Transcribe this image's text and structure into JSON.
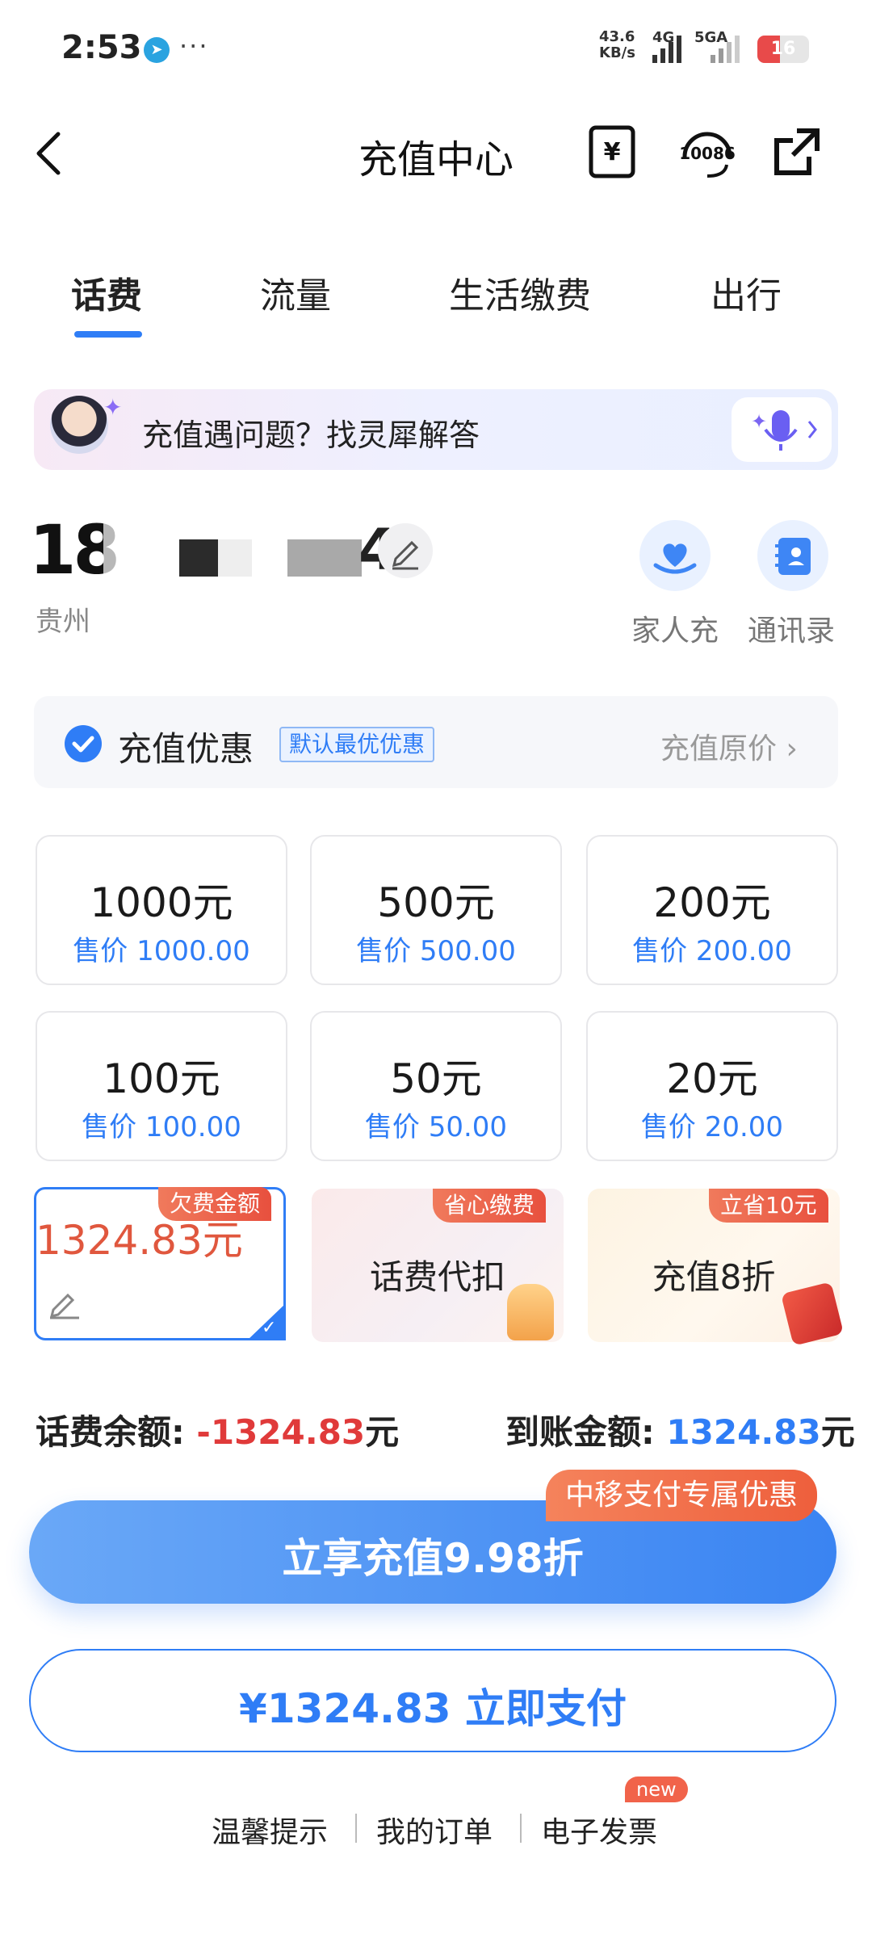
{
  "status_bar": {
    "time": "2:53",
    "net_speed_value": "43.6",
    "net_speed_unit": "KB/s",
    "net_type_1": "4G",
    "net_type_2": "5GA",
    "battery": "16",
    "battery_level": 0.16
  },
  "header": {
    "title": "充值中心",
    "service_number": "10086"
  },
  "tabs": [
    {
      "label": "话费"
    },
    {
      "label": "流量"
    },
    {
      "label": "生活缴费"
    },
    {
      "label": "出行"
    }
  ],
  "banner": {
    "text": "充值遇问题？找灵犀解答"
  },
  "account": {
    "phone_prefix": "18",
    "phone_suffix": "4",
    "region": "贵州"
  },
  "quick_actions": [
    {
      "label": "家人充"
    },
    {
      "label": "通讯录"
    }
  ],
  "promo": {
    "label": "充值优惠",
    "tag": "默认最优优惠",
    "right": "充值原价 ›"
  },
  "amounts": [
    {
      "amount": "1000元",
      "price": "售价 1000.00"
    },
    {
      "amount": "500元",
      "price": "售价 500.00"
    },
    {
      "amount": "200元",
      "price": "售价 200.00"
    },
    {
      "amount": "100元",
      "price": "售价 100.00"
    },
    {
      "amount": "50元",
      "price": "售价 50.00"
    },
    {
      "amount": "20元",
      "price": "售价 20.00"
    }
  ],
  "arrear_card": {
    "badge": "欠费金额",
    "value": "1324.83元"
  },
  "service_cards": [
    {
      "badge": "省心缴费",
      "label": "话费代扣"
    },
    {
      "badge": "立省10元",
      "label": "充值8折"
    }
  ],
  "balance": {
    "label": "话费余额:",
    "value": "-1324.83",
    "unit": "元"
  },
  "arrival": {
    "label": "到账金额:",
    "value": "1324.83",
    "unit": "元"
  },
  "buttons": {
    "main_label": "立享充值9.98折",
    "main_badge": "中移支付专属优惠",
    "pay_label": "¥1324.83 立即支付"
  },
  "footer": {
    "links": [
      "温馨提示",
      "我的订单",
      "电子发票"
    ],
    "new_badge": "new"
  },
  "colors": {
    "accent": "#2f7df6",
    "danger": "#e0573e",
    "badge": "#ee5f3c"
  }
}
